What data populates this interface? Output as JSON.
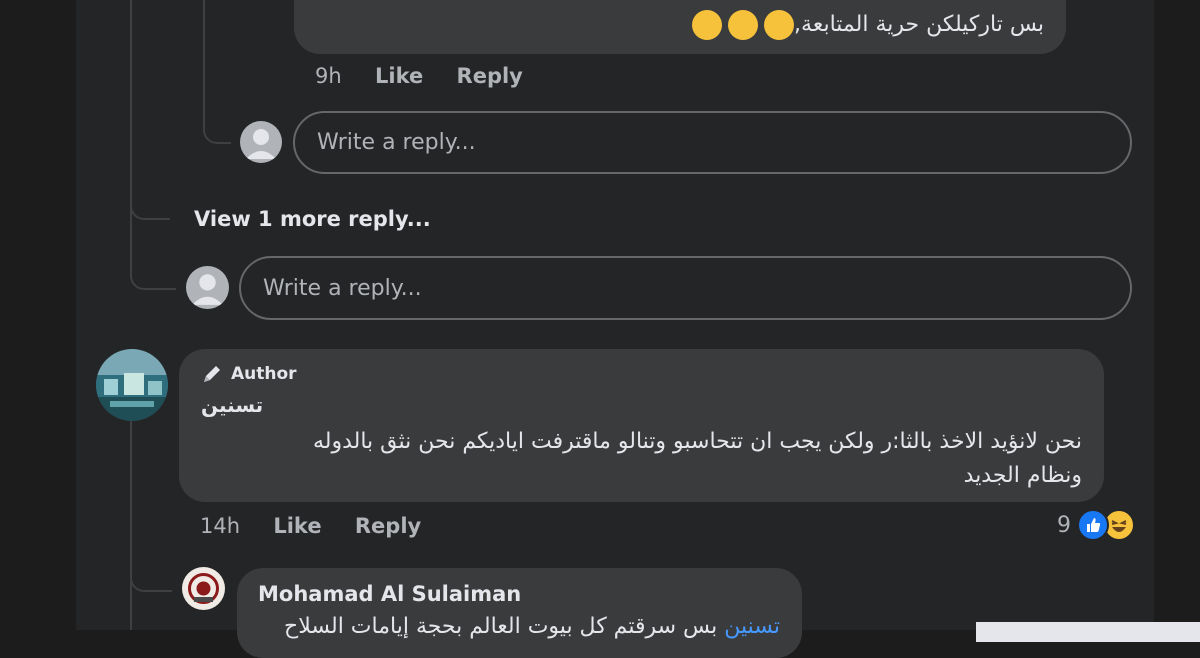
{
  "theme": {
    "background": "#242526",
    "bubble": "#3a3b3c",
    "text": "#e4e6eb",
    "secondary": "#b0b3b8",
    "like_blue": "#1877f2",
    "mention": "#4599ff"
  },
  "top_comment": {
    "text_line1": "بس تاركيلكن حرية المتابعة,",
    "emoji": "grinning-face-with-sweat",
    "time": "9h",
    "like": "Like",
    "reply": "Reply"
  },
  "reply_box_nested": {
    "placeholder": "Write a reply..."
  },
  "view_more": {
    "label": "View 1 more reply..."
  },
  "reply_box_thread": {
    "placeholder": "Write a reply..."
  },
  "author_comment": {
    "badge": "Author",
    "badge_icon": "pen-icon",
    "name": "تسنين",
    "text_line1": "نحن لانؤيد الاخذ بالثا:ر ولكن يجب ان تتحاسبو وتنالو ماقترفت اياديكم نحن نثق بالدوله",
    "text_line2": "ونظام الجديد",
    "time": "14h",
    "like": "Like",
    "reply": "Reply",
    "reactions_count": "9",
    "reactions": [
      "like-icon",
      "haha-icon"
    ]
  },
  "nested_reply": {
    "name": "Mohamad Al Sulaiman",
    "mention": "تسنين",
    "text": "بس سرقتم كل بيوت العالم بحجة إيامات السلاح"
  }
}
